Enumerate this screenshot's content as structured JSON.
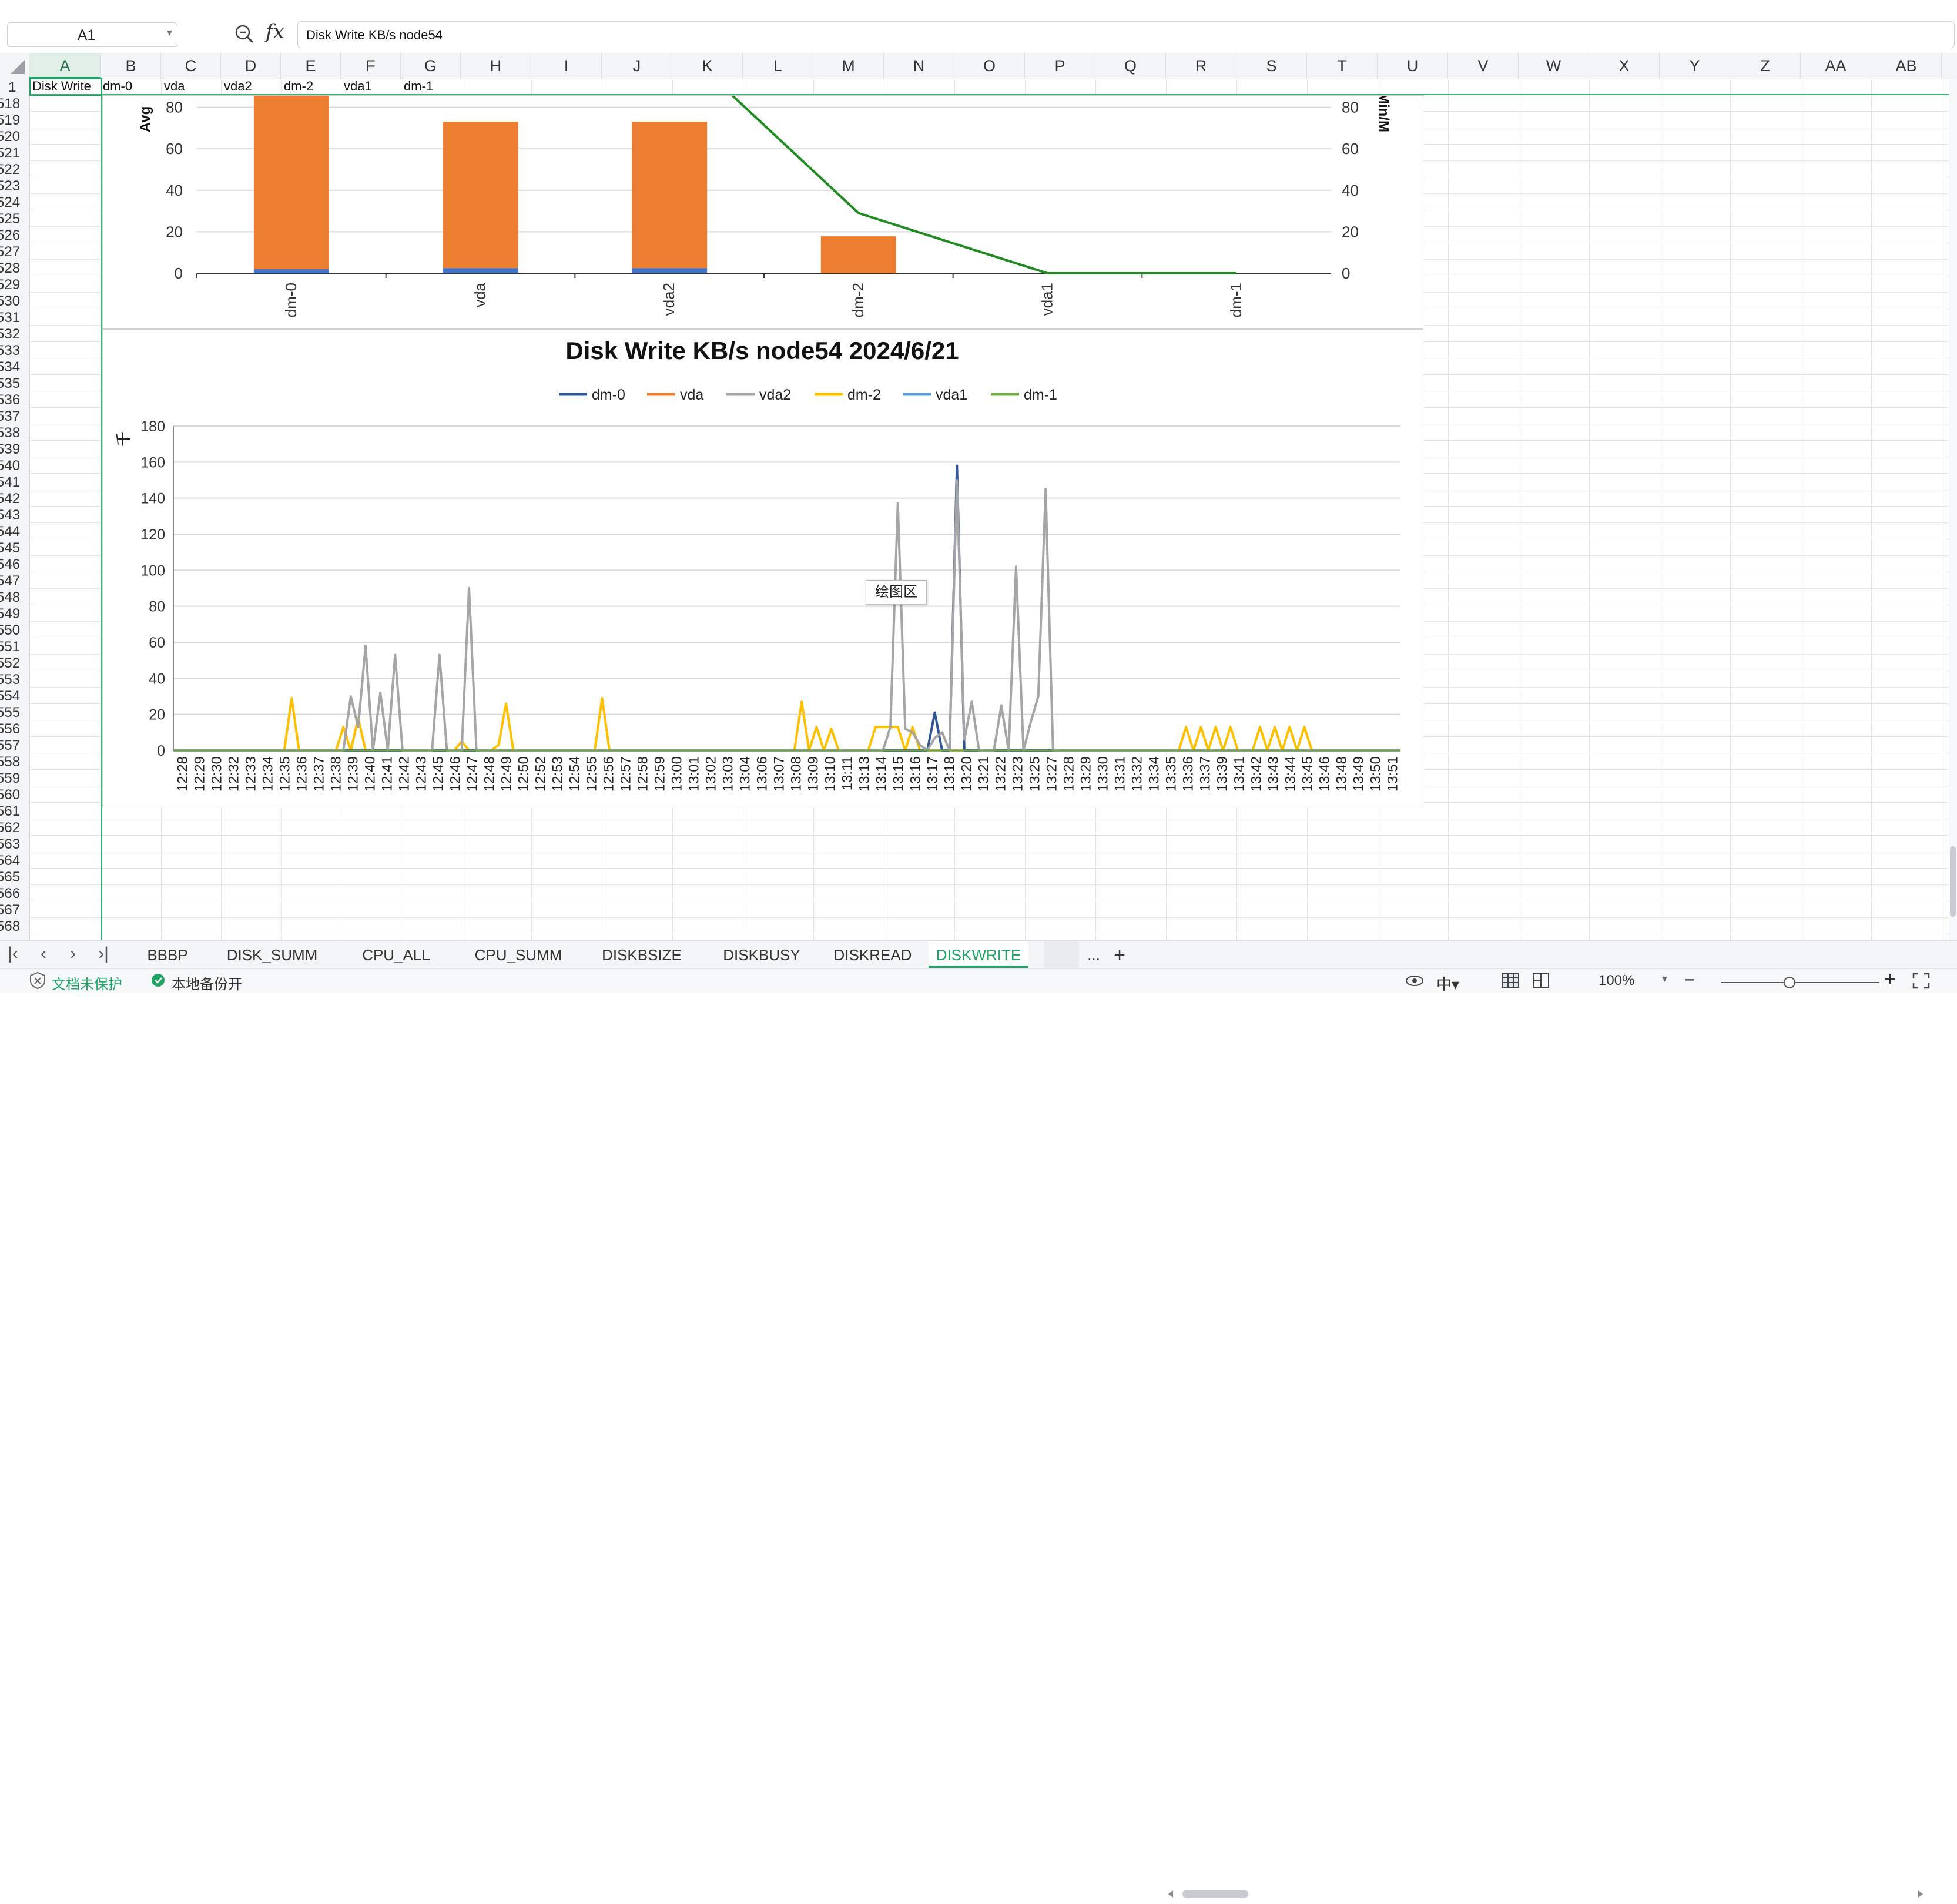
{
  "app": {
    "name_box": "A1",
    "formula_text": "Disk Write KB/s node54",
    "fx_label": "fx"
  },
  "columns": [
    "A",
    "B",
    "C",
    "D",
    "E",
    "F",
    "G",
    "H",
    "I",
    "J",
    "K",
    "L",
    "M",
    "N",
    "O",
    "P",
    "Q",
    "R",
    "S",
    "T",
    "U",
    "V",
    "W",
    "X",
    "Y",
    "Z",
    "AA",
    "AB"
  ],
  "rows": [
    "1",
    "518",
    "519",
    "520",
    "521",
    "522",
    "523",
    "524",
    "525",
    "526",
    "527",
    "528",
    "529",
    "530",
    "531",
    "532",
    "533",
    "534",
    "535",
    "536",
    "537",
    "538",
    "539",
    "540",
    "541",
    "542",
    "543",
    "544",
    "545",
    "546",
    "547",
    "548",
    "549",
    "550",
    "551",
    "552",
    "553",
    "554",
    "555",
    "556",
    "557",
    "558",
    "559",
    "560",
    "561",
    "562",
    "563",
    "564",
    "565",
    "566",
    "567",
    "568"
  ],
  "row1": [
    "Disk  Write",
    "dm-0",
    "vda",
    "vda2",
    "dm-2",
    "vda1",
    "dm-1"
  ],
  "chart_data": [
    {
      "type": "bar",
      "title": "",
      "categories": [
        "dm-0",
        "vda",
        "vda2",
        "dm-2",
        "vda1",
        "dm-1"
      ],
      "y_left_label": "Avg",
      "y_right_label": "Min/M",
      "ylim": [
        0,
        85
      ],
      "yticks": [
        0,
        20,
        40,
        60,
        80
      ],
      "series": [
        {
          "type": "bar",
          "color": "#4472c4",
          "values": [
            2,
            2.5,
            2.5,
            0,
            0,
            0
          ]
        },
        {
          "type": "bar",
          "color": "#ed7d31",
          "values": [
            86,
            70.5,
            70.5,
            17.8,
            0,
            0
          ]
        },
        {
          "type": "line",
          "color": "#1e8c1e",
          "axis": "right",
          "values": [
            null,
            null,
            null,
            29,
            0,
            0
          ],
          "upper_offscreen": true
        }
      ]
    },
    {
      "type": "line",
      "title": "Disk Write KB/s node54  2024/6/21",
      "ylabel": "千",
      "ylim": [
        0,
        180
      ],
      "yticks": [
        0,
        20,
        40,
        60,
        80,
        100,
        120,
        140,
        160,
        180
      ],
      "x": [
        "12:28",
        "12:29",
        "12:30",
        "12:32",
        "12:33",
        "12:34",
        "12:35",
        "12:36",
        "12:37",
        "12:38",
        "12:39",
        "12:40",
        "12:41",
        "12:42",
        "12:43",
        "12:45",
        "12:46",
        "12:47",
        "12:48",
        "12:49",
        "12:50",
        "12:52",
        "12:53",
        "12:54",
        "12:55",
        "12:56",
        "12:57",
        "12:58",
        "12:59",
        "13:00",
        "13:01",
        "13:02",
        "13:03",
        "13:04",
        "13:06",
        "13:07",
        "13:08",
        "13:09",
        "13:10",
        "13:11",
        "13:13",
        "13:14",
        "13:15",
        "13:16",
        "13:17",
        "13:18",
        "13:20",
        "13:21",
        "13:22",
        "13:23",
        "13:25",
        "13:27",
        "13:28",
        "13:29",
        "13:30",
        "13:31",
        "13:32",
        "13:34",
        "13:35",
        "13:36",
        "13:37",
        "13:39",
        "13:41",
        "13:42",
        "13:43",
        "13:44",
        "13:45",
        "13:46",
        "13:48",
        "13:49",
        "13:50",
        "13:51"
      ],
      "series": [
        {
          "name": "dm-0",
          "color": "#2f5597",
          "peaks": [
            [
              103,
              21
            ],
            [
              106,
              158
            ]
          ]
        },
        {
          "name": "vda",
          "color": "#ed7d31",
          "peaks": []
        },
        {
          "name": "vda2",
          "color": "#a5a5a5",
          "peaks": [
            [
              24,
              30
            ],
            [
              25,
              13
            ],
            [
              26,
              58
            ],
            [
              28,
              32
            ],
            [
              30,
              53
            ],
            [
              36,
              53
            ],
            [
              40,
              90
            ],
            [
              97,
              13
            ],
            [
              98,
              137
            ],
            [
              99,
              12
            ],
            [
              100,
              10
            ],
            [
              101,
              3
            ],
            [
              103,
              7
            ],
            [
              104,
              10
            ],
            [
              106,
              150
            ],
            [
              107,
              6
            ],
            [
              108,
              27
            ],
            [
              112,
              25
            ],
            [
              114,
              102
            ],
            [
              116,
              16
            ],
            [
              117,
              30
            ],
            [
              118,
              145
            ]
          ]
        },
        {
          "name": "dm-2",
          "color": "#ffc000",
          "peaks": [
            [
              16,
              29
            ],
            [
              23,
              13
            ],
            [
              25,
              18
            ],
            [
              39,
              5
            ],
            [
              44,
              3
            ],
            [
              45,
              26
            ],
            [
              58,
              29
            ],
            [
              85,
              27
            ],
            [
              87,
              13
            ],
            [
              89,
              12
            ],
            [
              95,
              13
            ],
            [
              96,
              13
            ],
            [
              97,
              13
            ],
            [
              98,
              13
            ],
            [
              100,
              13
            ],
            [
              137,
              13
            ],
            [
              139,
              13
            ],
            [
              141,
              13
            ],
            [
              143,
              13
            ],
            [
              147,
              13
            ],
            [
              149,
              13
            ],
            [
              151,
              13
            ],
            [
              153,
              13
            ]
          ]
        },
        {
          "name": "vda1",
          "color": "#5b9bd5",
          "peaks": []
        },
        {
          "name": "dm-1",
          "color": "#70ad47",
          "peaks": []
        }
      ]
    }
  ],
  "tooltip": "绘图区",
  "sheets": [
    "BBBP",
    "DISK_SUMM",
    "CPU_ALL",
    "CPU_SUMM",
    "DISKBSIZE",
    "DISKBUSY",
    "DISKREAD",
    "DISKWRITE"
  ],
  "active_sheet": "DISKWRITE",
  "more_tabs": "...",
  "add_tab": "+",
  "status": {
    "unprotected": "文档未保护",
    "backup": "本地备份开",
    "zoom": "100%"
  },
  "colors": {
    "accent": "#21a366",
    "grid": "#e3e5e8"
  }
}
